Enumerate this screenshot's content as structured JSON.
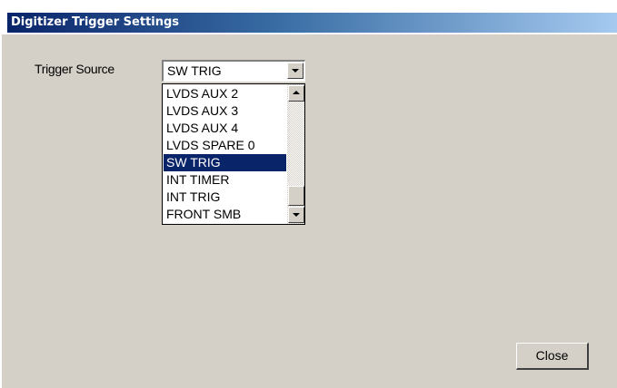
{
  "window": {
    "title": "Digitizer Trigger Settings"
  },
  "trigger_source": {
    "label": "Trigger Source",
    "selected_value": "SW TRIG",
    "options": [
      "LVDS AUX 2",
      "LVDS AUX 3",
      "LVDS AUX 4",
      "LVDS SPARE 0",
      "SW TRIG",
      "INT TIMER",
      "INT TRIG",
      "FRONT SMB"
    ],
    "selected_index": 4
  },
  "buttons": {
    "close_label": "Close"
  },
  "icons": {
    "dropdown": "chevron-down-icon",
    "scroll_up": "arrow-up-icon",
    "scroll_down": "arrow-down-icon"
  },
  "colors": {
    "titlebar_start": "#0a246a",
    "titlebar_end": "#a6caf0",
    "selection": "#0a246a",
    "face": "#d4d0c8"
  }
}
